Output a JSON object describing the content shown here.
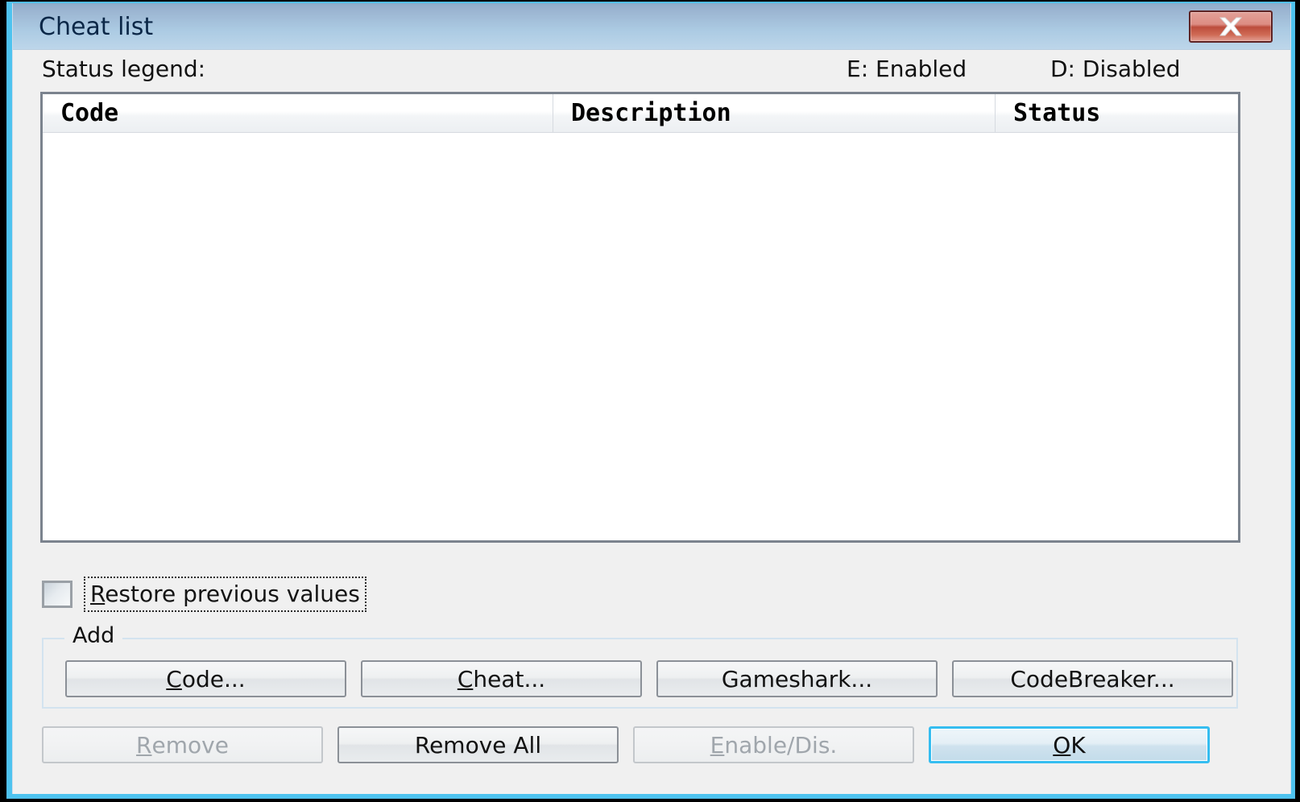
{
  "window": {
    "title": "Cheat list",
    "close_icon": "close-icon"
  },
  "legend": {
    "label": "Status legend:",
    "enabled": "E: Enabled",
    "disabled": "D: Disabled"
  },
  "list": {
    "columns": [
      "Code",
      "Description",
      "Status"
    ],
    "rows": []
  },
  "options": {
    "restore_checkbox_checked": false,
    "restore_label_accel": "R",
    "restore_label_rest": "estore previous values"
  },
  "add_group": {
    "legend": "Add",
    "buttons": [
      {
        "accel": "C",
        "rest": "ode...",
        "enabled": true
      },
      {
        "accel": "C",
        "rest": "heat...",
        "enabled": true
      },
      {
        "accel": "",
        "rest": "Gameshark...",
        "enabled": true
      },
      {
        "accel": "",
        "rest": "CodeBreaker...",
        "enabled": true
      }
    ]
  },
  "bottom_buttons": [
    {
      "accel": "R",
      "rest": "emove",
      "enabled": false,
      "default": false
    },
    {
      "accel": "",
      "rest": "Remove All",
      "enabled": true,
      "default": false
    },
    {
      "accel": "E",
      "rest": "nable/Dis.",
      "enabled": false,
      "default": false
    },
    {
      "accel": "O",
      "rest": "K",
      "enabled": true,
      "default": true
    }
  ],
  "colors": {
    "titlebar_top": "#8fabca",
    "titlebar_bottom": "#bdd6ea",
    "dialog_bg": "#f0f0f0",
    "frame_accent": "#4ec3ef",
    "close_button": "#bc4d3c",
    "default_button_border": "#35bdf0",
    "listview_border": "#7b838e",
    "groupbox_border": "#d3e3ef",
    "disabled_text": "#a0a6ac"
  }
}
